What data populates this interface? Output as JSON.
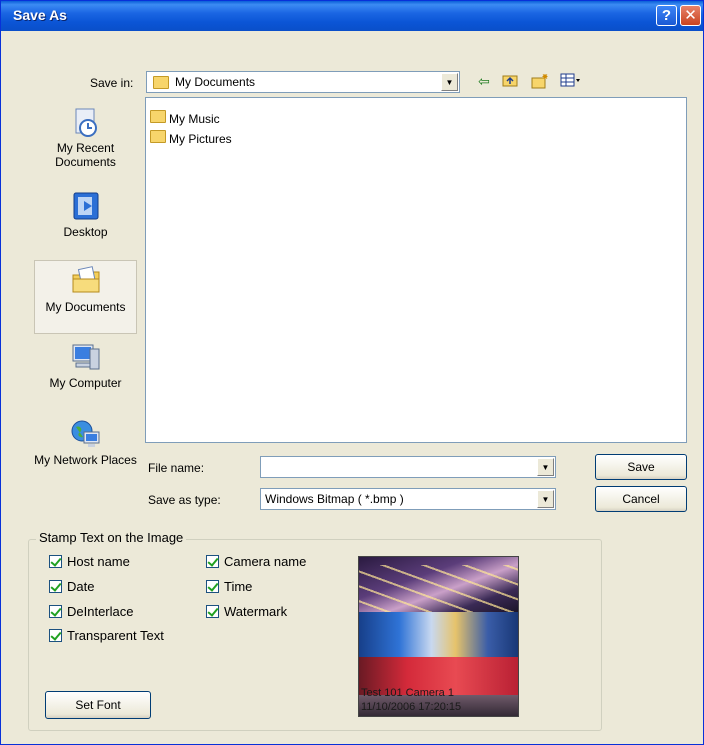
{
  "window": {
    "title": "Save As",
    "help_label": "?",
    "close_label": "✕"
  },
  "save_in": {
    "label": "Save in:",
    "value": "My Documents",
    "toolbar_icons": [
      "back-arrow-icon",
      "up-one-level-icon",
      "new-folder-icon",
      "view-menu-icon"
    ]
  },
  "places": [
    {
      "label": "My Recent Documents",
      "icon": "recent-documents-icon"
    },
    {
      "label": "Desktop",
      "icon": "desktop-icon"
    },
    {
      "label": "My Documents",
      "icon": "my-documents-icon",
      "selected": true
    },
    {
      "label": "My Computer",
      "icon": "my-computer-icon"
    },
    {
      "label": "My Network Places",
      "icon": "network-places-icon"
    }
  ],
  "files": [
    {
      "name": "My Music",
      "icon": "music-folder-icon"
    },
    {
      "name": "My Pictures",
      "icon": "pictures-folder-icon"
    }
  ],
  "file_name": {
    "label": "File name:",
    "value": ""
  },
  "save_as_type": {
    "label": "Save as type:",
    "value": "Windows Bitmap ( *.bmp )"
  },
  "buttons": {
    "save": "Save",
    "cancel": "Cancel",
    "set_font": "Set Font"
  },
  "stamp": {
    "legend": "Stamp Text on the Image",
    "options": [
      {
        "label": "Host name",
        "checked": true
      },
      {
        "label": "Camera name",
        "checked": true
      },
      {
        "label": "Date",
        "checked": true
      },
      {
        "label": "Time",
        "checked": true
      },
      {
        "label": "DeInterlace",
        "checked": true
      },
      {
        "label": "Watermark",
        "checked": true
      },
      {
        "label": "Transparent Text",
        "checked": true
      }
    ],
    "preview_line1": "Test 101 Camera 1",
    "preview_line2": "11/10/2006 17:20:15"
  }
}
